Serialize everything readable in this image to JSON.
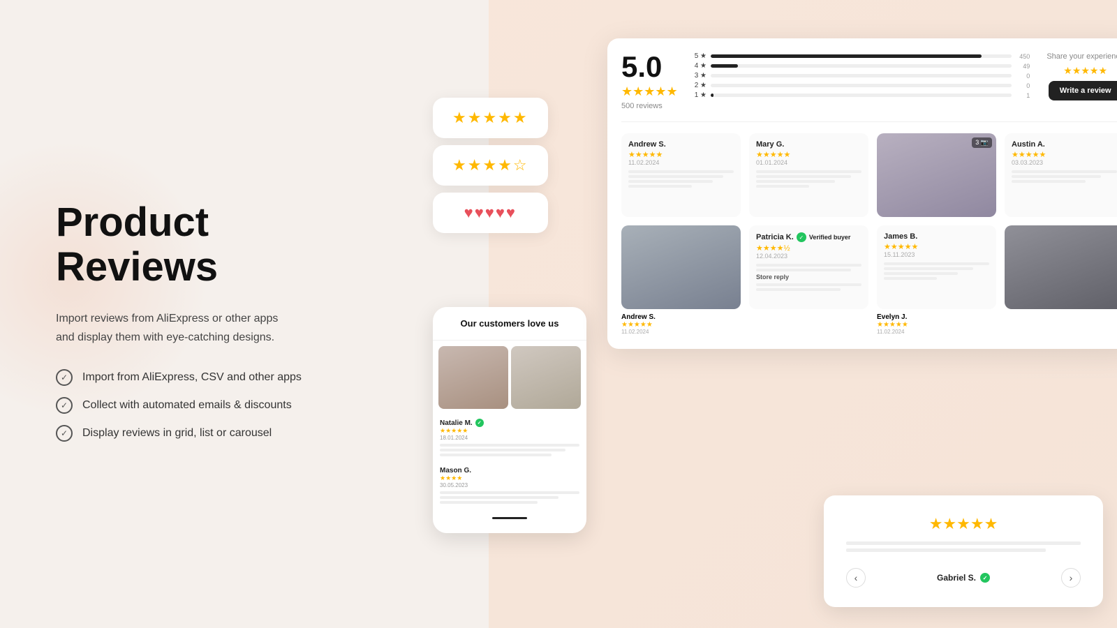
{
  "page": {
    "title": "Product Reviews",
    "description_line1": "Import reviews from AliExpress or other apps",
    "description_line2": "and display them with eye-catching designs.",
    "features": [
      "Import from AliExpress, CSV and other apps",
      "Collect with automated emails & discounts",
      "Display reviews in grid, list or carousel"
    ]
  },
  "overall_rating": {
    "score": "5.0",
    "stars": "★★★★★",
    "count": "500 reviews",
    "bars": [
      {
        "label": "5",
        "fill": 90,
        "count": "450"
      },
      {
        "label": "4",
        "fill": 9,
        "count": "49"
      },
      {
        "label": "3",
        "fill": 0,
        "count": "0"
      },
      {
        "label": "2",
        "fill": 0,
        "count": "0"
      },
      {
        "label": "1",
        "fill": 0,
        "count": "1"
      }
    ],
    "share_title": "Share your experience",
    "share_stars": "★★★★★",
    "write_review_label": "Write a review"
  },
  "mobile_widget": {
    "header": "Our customers love us",
    "reviewers": [
      {
        "name": "Natalie M.",
        "verified": true,
        "stars": "★★★★★",
        "date": "18.01.2024"
      },
      {
        "name": "Mason G.",
        "verified": false,
        "stars": "★★★★",
        "date": "30.05.2023"
      }
    ]
  },
  "reviews": [
    {
      "name": "Andrew S.",
      "stars": "★★★★★",
      "date": "11.02.2024",
      "has_photo": false
    },
    {
      "name": "Mary G.",
      "stars": "★★★★★",
      "date": "01.01.2024",
      "has_photo": false
    },
    {
      "name": "Austin A.",
      "stars": "★★★★★",
      "date": "03.03.2023",
      "has_photo": false
    },
    {
      "name": "Andrew S.",
      "stars": "★★★★★",
      "date": "11.02.2024",
      "has_photo": true,
      "photo_type": "sneakers"
    },
    {
      "name": "Patricia K.",
      "stars": "★★★★½",
      "date": "12.04.2023",
      "has_photo": false,
      "verified": true
    },
    {
      "name": "James B.",
      "stars": "★★★★★",
      "date": "15.11.2023",
      "has_photo": false
    },
    {
      "name": "Evelyn J.",
      "stars": "★★★★★",
      "date": "11.02.2024",
      "has_photo": true,
      "photo_type": "sneakers2"
    }
  ],
  "carousel": {
    "stars": "★★★★★",
    "reviewer": "Gabriel S.",
    "verified": true
  },
  "icons": {
    "checkmark": "✓",
    "prev_arrow": "‹",
    "next_arrow": "›",
    "verified_check": "✓",
    "star": "★"
  }
}
